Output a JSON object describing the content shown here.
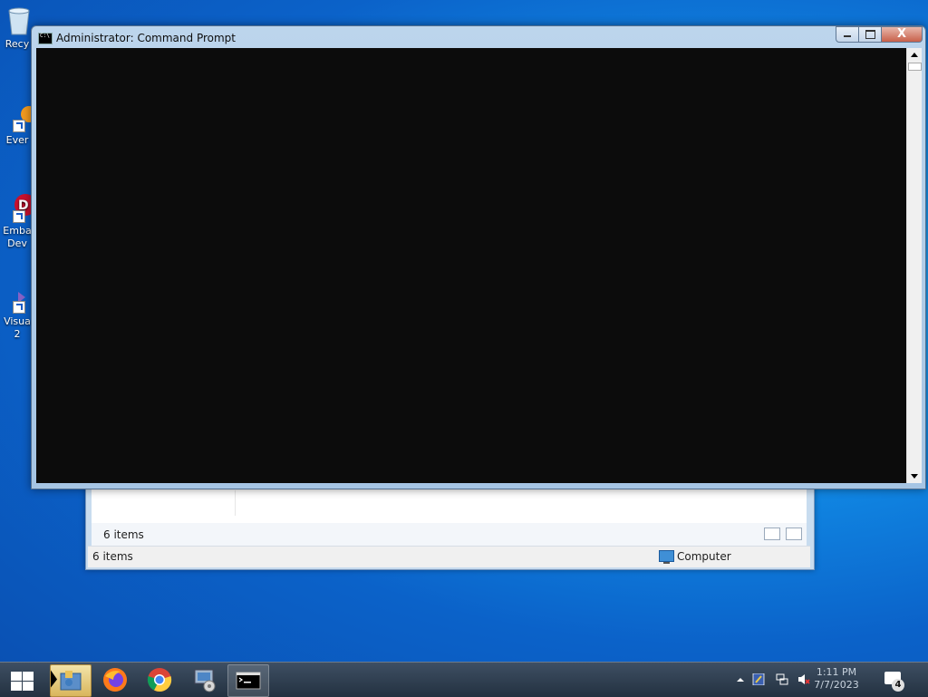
{
  "desktop": {
    "icons": [
      {
        "label": "Recy",
        "name": "recycle-bin"
      },
      {
        "label": "Ever",
        "name": "everything"
      },
      {
        "label": "Emba Dev",
        "name": "embarcadero-dev"
      },
      {
        "label": "Visua 2",
        "name": "visual-studio"
      }
    ]
  },
  "cmd_window": {
    "title": "Administrator:  Command Prompt",
    "close_glyph": "X"
  },
  "explorer_window": {
    "details_count": "6 items",
    "status_count": "6 items",
    "status_location": "Computer"
  },
  "taskbar": {
    "pinned": [
      {
        "name": "file-explorer",
        "active": true
      },
      {
        "name": "firefox"
      },
      {
        "name": "chrome"
      },
      {
        "name": "remote-desktop"
      },
      {
        "name": "command-prompt",
        "active": true
      }
    ],
    "clock_time": "1:11 PM",
    "clock_date": "7/7/2023",
    "notification_count": "4"
  }
}
